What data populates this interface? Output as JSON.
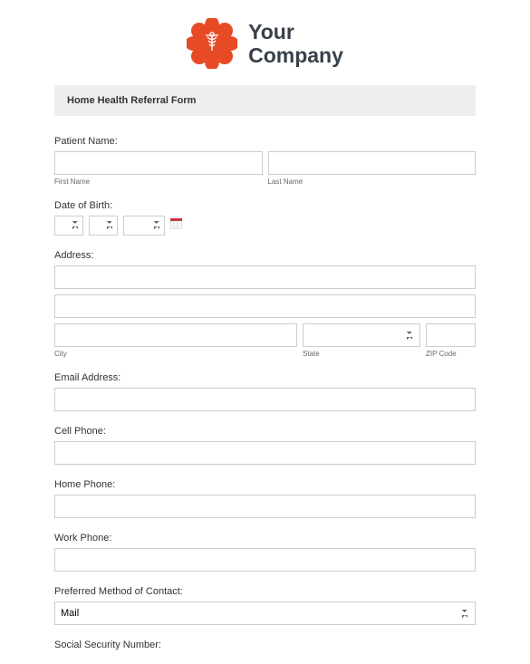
{
  "company_name_line1": "Your",
  "company_name_line2": "Company",
  "form_title": "Home Health Referral Form",
  "fields": {
    "patient_name": {
      "label": "Patient Name:",
      "first_sub": "First Name",
      "last_sub": "Last Name",
      "first_val": "",
      "last_val": ""
    },
    "dob": {
      "label": "Date of Birth:",
      "month": "",
      "day": "",
      "year": ""
    },
    "address": {
      "label": "Address:",
      "line1": "",
      "line2": "",
      "city": "",
      "state": "",
      "zip": "",
      "city_sub": "City",
      "state_sub": "State",
      "zip_sub": "ZIP Code"
    },
    "email": {
      "label": "Email Address:",
      "value": ""
    },
    "cell": {
      "label": "Cell Phone:",
      "value": ""
    },
    "home": {
      "label": "Home Phone:",
      "value": ""
    },
    "work": {
      "label": "Work Phone:",
      "value": ""
    },
    "contact_method": {
      "label": "Preferred Method of Contact:",
      "selected": "Mail",
      "options": [
        "Mail"
      ]
    },
    "ssn": {
      "label": "Social Security Number:"
    }
  }
}
